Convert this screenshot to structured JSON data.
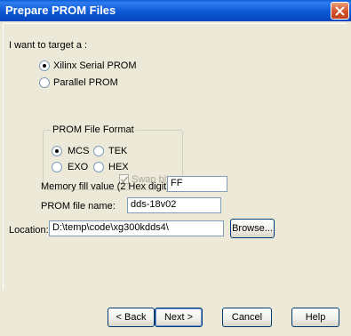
{
  "window": {
    "title": "Prepare PROM Files"
  },
  "target": {
    "heading": "I want to target a :",
    "options": [
      {
        "label": "Xilinx Serial PROM",
        "checked": true
      },
      {
        "label": "Parallel PROM",
        "checked": false
      }
    ]
  },
  "format": {
    "group_title": "PROM File Format",
    "options": [
      {
        "label": "MCS",
        "checked": true
      },
      {
        "label": "TEK",
        "checked": false
      },
      {
        "label": "EXO",
        "checked": false
      },
      {
        "label": "HEX",
        "checked": false
      }
    ],
    "swap_bits": {
      "label": "Swap bits",
      "checked": true,
      "disabled": true
    }
  },
  "fields": {
    "fill_label": "Memory fill value (2 Hex digit):",
    "fill_value": "FF",
    "name_label": "PROM file name:",
    "name_value": "dds-18v02",
    "location_label": "Location:",
    "location_value": "D:\\temp\\code\\xg300kdds4\\",
    "browse_label": "Browse..."
  },
  "buttons": {
    "back": "< Back",
    "next": "Next >",
    "cancel": "Cancel",
    "help": "Help"
  }
}
